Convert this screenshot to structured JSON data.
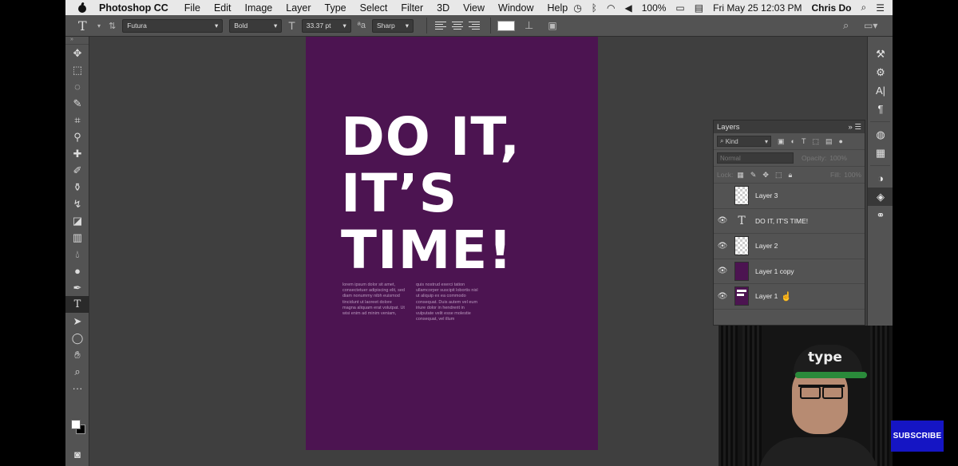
{
  "menubar": {
    "app_name": "Photoshop CC",
    "menus": [
      "File",
      "Edit",
      "Image",
      "Layer",
      "Type",
      "Select",
      "Filter",
      "3D",
      "View",
      "Window",
      "Help"
    ],
    "battery": "100%",
    "datetime": "Fri May 25  12:03 PM",
    "user": "Chris Do"
  },
  "options": {
    "font_family": "Futura",
    "font_style": "Bold",
    "font_size": "33.37 pt",
    "antialias": "Sharp",
    "text_color": "#ffffff"
  },
  "document": {
    "background": "#4c1451",
    "headline_lines": [
      "DO IT,",
      "IT’S",
      "TIME!"
    ],
    "body_col1": "lorem ipsum dolor sit amet, consectetuer adipiscing elit, sed diam nonummy nibh euismod tincidunt ut laoreet dolore magna aliquam erat volutpat. Ut wisi enim ad minim veniam,",
    "body_col2": "quis nostrud exerci tation ullamcorper suscipit lobortis nisl ut aliquip ex ea commodo consequat. Duis autem vel eum iriure dolor in hendrerit in vulputate velit esse molestie consequat, vel illum"
  },
  "layers_panel": {
    "title": "Layers",
    "filter_kind": "Kind",
    "blend_mode": "Normal",
    "opacity_label": "Opacity:",
    "opacity_value": "100%",
    "lock_label": "Lock:",
    "fill_label": "Fill:",
    "fill_value": "100%",
    "layers": [
      {
        "name": "Layer 3",
        "visible": false,
        "thumb": "checker"
      },
      {
        "name": "DO IT, IT'S TIME!",
        "visible": true,
        "thumb": "type"
      },
      {
        "name": "Layer 2",
        "visible": true,
        "thumb": "checker"
      },
      {
        "name": "Layer 1 copy",
        "visible": true,
        "thumb": "purple"
      },
      {
        "name": "Layer 1",
        "visible": true,
        "thumb": "mixed"
      }
    ]
  },
  "webcam": {
    "cap_text": "type"
  },
  "overlay": {
    "subscribe_label": "SUBSCRIBE"
  }
}
